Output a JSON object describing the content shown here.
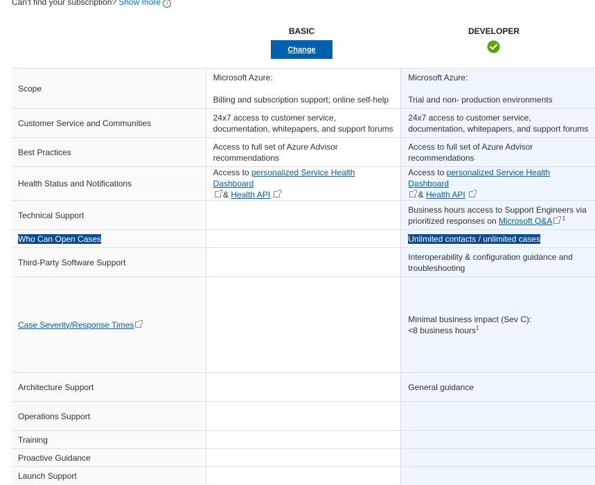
{
  "top": {
    "question": "Can't find your subscription?",
    "show_more": "Show more"
  },
  "plans": {
    "basic": {
      "name": "BASIC",
      "button": "Change"
    },
    "developer": {
      "name": "DEVELOPER",
      "selected_icon": "check-circle-icon",
      "selected_color": "#57a300"
    }
  },
  "rows": [
    {
      "label": "Scope",
      "basic_l1": "Microsoft Azure:",
      "basic_l2": "Billing and subscription support; online self-help",
      "dev_l1": "Microsoft Azure:",
      "dev_l2": "Trial and non- production environments"
    },
    {
      "label": "Customer Service and Communities",
      "basic": "24x7 access to customer service, documentation, whitepapers, and support forums",
      "dev": "24x7 access to customer service, documentation, whitepapers, and support forums"
    },
    {
      "label": "Best Practices",
      "basic": "Access to full set of Azure Advisor recommendations",
      "dev": "Access to full set of Azure Advisor recommendations"
    },
    {
      "label": "Health Status and Notifications",
      "prefix": "Access to",
      "link1": "personalized Service Health Dashboard",
      "amp": "&",
      "link2": "Health API"
    },
    {
      "label": "Technical Support",
      "dev_text": "Business hours access to Support Engineers via prioritized responses on",
      "dev_link": "Microsoft Q&A",
      "dev_sup": "1"
    },
    {
      "label": "Who Can Open Cases",
      "dev": "Unlimited contacts / unlimited cases"
    },
    {
      "label": "Third-Party Software Support",
      "dev": "Interoperability & configuration guidance and troubleshooting"
    },
    {
      "label": "Case Severity/Response Times",
      "dev_l1": "Minimal business impact (Sev C):",
      "dev_l2": "<8 business hours",
      "dev_sup": "1"
    },
    {
      "label": "Architecture Support",
      "dev": "General guidance"
    },
    {
      "label": "Operations Support"
    },
    {
      "label": "Training"
    },
    {
      "label": "Proactive Guidance"
    },
    {
      "label": "Launch Support"
    }
  ]
}
